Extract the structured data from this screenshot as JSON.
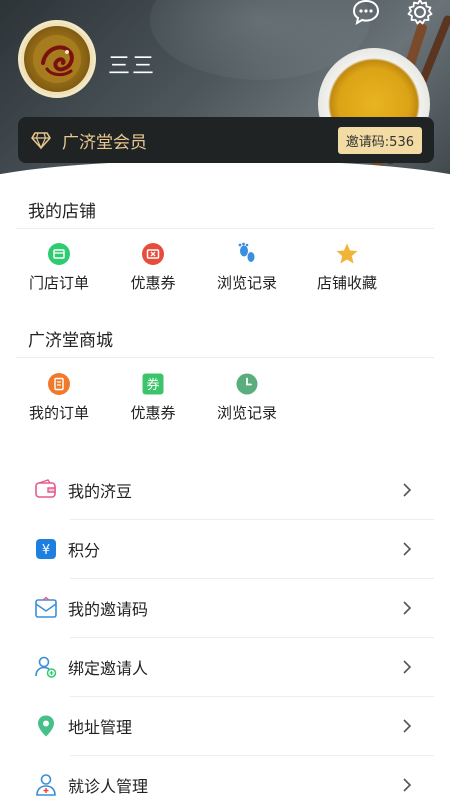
{
  "profile": {
    "username": "三三",
    "avatar_icon": "dragon-emblem-icon"
  },
  "header_icons": {
    "message": "chat-bubble-icon",
    "settings": "gear-icon"
  },
  "member": {
    "label": "广济堂会员",
    "invite_code": "邀请码:536",
    "icon": "diamond-icon"
  },
  "my_store": {
    "title": "我的店铺",
    "items": [
      {
        "label": "门店订单",
        "icon": "store-order-icon",
        "color": "#2ecc71"
      },
      {
        "label": "优惠券",
        "icon": "coupon-icon",
        "color": "#e74c3c"
      },
      {
        "label": "浏览记录",
        "icon": "footprint-icon",
        "color": "#3b8fe0"
      },
      {
        "label": "店铺收藏",
        "icon": "star-icon",
        "color": "#f0b43a"
      }
    ]
  },
  "mall": {
    "title": "广济堂商城",
    "items": [
      {
        "label": "我的订单",
        "icon": "order-list-icon",
        "color": "#f07a2c"
      },
      {
        "label": "优惠券",
        "icon": "coupon-ticket-icon",
        "color": "#3cc46a"
      },
      {
        "label": "浏览记录",
        "icon": "clock-icon",
        "color": "#5aae7e"
      }
    ]
  },
  "menu": [
    {
      "label": "我的济豆",
      "icon": "wallet-icon"
    },
    {
      "label": "积分",
      "icon": "yen-points-icon"
    },
    {
      "label": "我的邀请码",
      "icon": "invite-envelope-icon"
    },
    {
      "label": "绑定邀请人",
      "icon": "bind-user-icon"
    },
    {
      "label": "地址管理",
      "icon": "location-pin-icon"
    },
    {
      "label": "就诊人管理",
      "icon": "doctor-patient-icon"
    }
  ]
}
